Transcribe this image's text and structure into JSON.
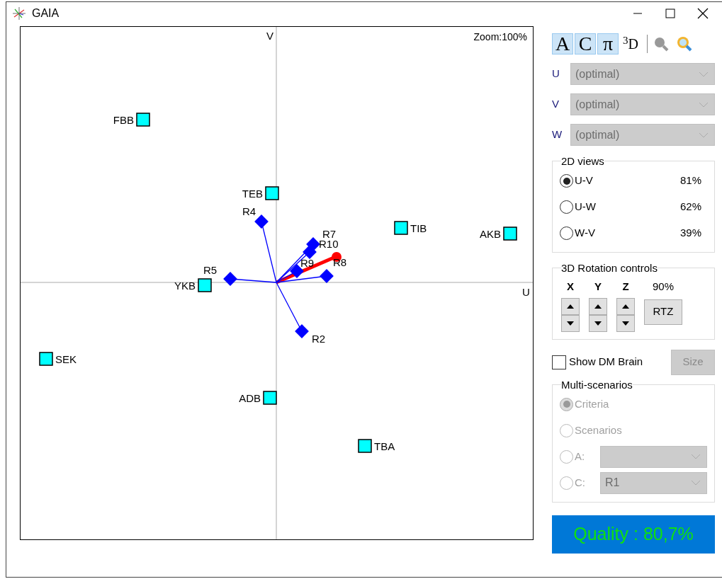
{
  "window": {
    "title": "GAIA"
  },
  "plot": {
    "zoom": "Zoom:100%",
    "v_axis": "V",
    "u_axis": "U",
    "alternatives": [
      {
        "label": "FBB"
      },
      {
        "label": "TEB"
      },
      {
        "label": "TIB"
      },
      {
        "label": "AKB"
      },
      {
        "label": "YKB"
      },
      {
        "label": "SEK"
      },
      {
        "label": "ADB"
      },
      {
        "label": "TBA"
      }
    ],
    "criteria": [
      {
        "label": "R4"
      },
      {
        "label": "R5"
      },
      {
        "label": "R7"
      },
      {
        "label": "R10"
      },
      {
        "label": "R9"
      },
      {
        "label": "R8"
      },
      {
        "label": "R2"
      }
    ]
  },
  "toolbar": [
    {
      "label": "A",
      "selected": true
    },
    {
      "label": "C",
      "selected": true
    },
    {
      "label": "π",
      "selected": true
    },
    {
      "label": "$^{3}$D",
      "selected": false
    }
  ],
  "axes": [
    {
      "label": "U",
      "value": "(optimal)",
      "disabled": true
    },
    {
      "label": "V",
      "value": "(optimal)",
      "disabled": true
    },
    {
      "label": "W",
      "value": "(optimal)",
      "disabled": true
    }
  ],
  "views_2d": {
    "title": "2D views",
    "options": [
      {
        "label": "U-V",
        "value": "81%",
        "selected": true
      },
      {
        "label": "U-W",
        "value": "62%",
        "selected": false
      },
      {
        "label": "W-V",
        "value": "39%",
        "selected": false
      }
    ]
  },
  "rotation": {
    "title": "3D Rotation controls",
    "axes": [
      "X",
      "Y",
      "Z"
    ],
    "percent": "90%",
    "reset": "RTZ"
  },
  "dm_brain": {
    "label": "Show DM Brain",
    "checked": false
  },
  "size_button": {
    "label": "Size",
    "disabled": true
  },
  "multi": {
    "title": "Multi-scenarios",
    "options": [
      {
        "kind": "radio",
        "label": "Criteria",
        "selected": true
      },
      {
        "kind": "radio",
        "label": "Scenarios",
        "selected": false
      },
      {
        "kind": "select",
        "label": "A:",
        "selected": false
      },
      {
        "kind": "select",
        "label": "C:",
        "selected": false,
        "value": "R1"
      }
    ]
  },
  "quality": "Quality : 80,7%"
}
